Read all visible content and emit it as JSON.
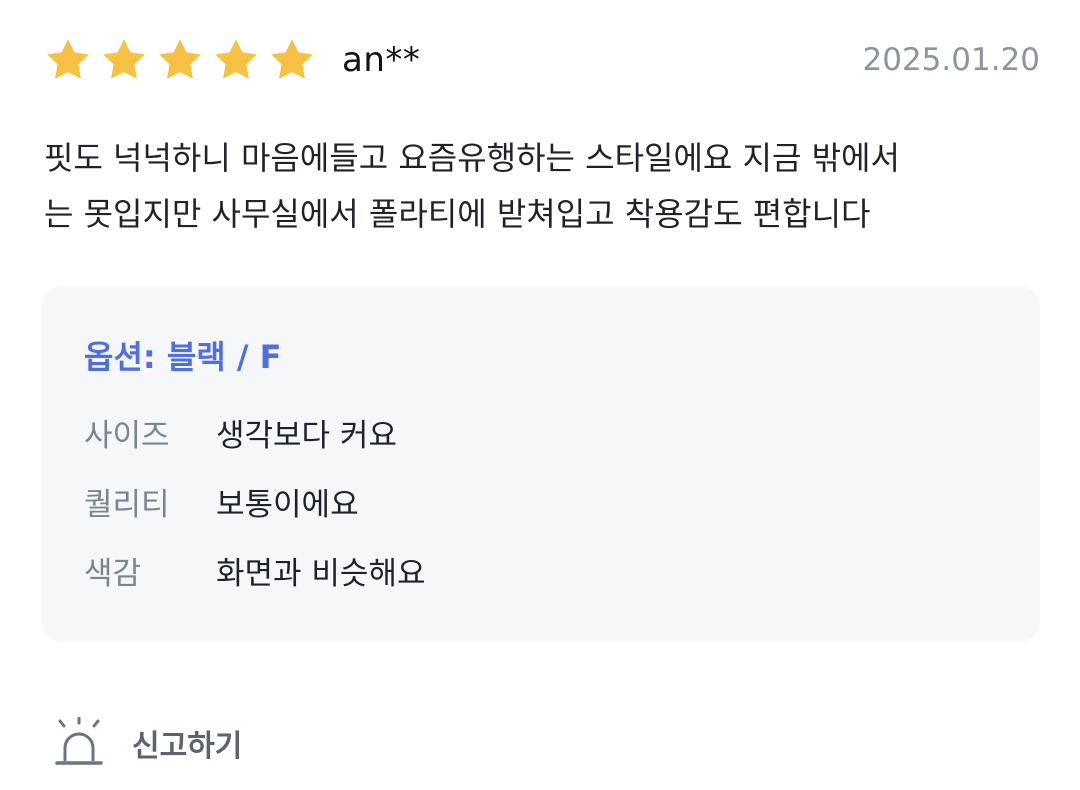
{
  "review": {
    "rating": 5,
    "rating_max": 5,
    "reviewer": "an**",
    "date": "2025.01.20",
    "text_lines": [
      "핏도 넉넉하니 마음에들고 요즘유행하는 스타일에요 지금 밖에서",
      "는 못입지만 사무실에서 폴라티에 받쳐입고 착용감도 편합니다"
    ]
  },
  "options": {
    "title": "옵션: 블랙 / F",
    "attributes": [
      {
        "label": "사이즈",
        "value": "생각보다 커요"
      },
      {
        "label": "퀄리티",
        "value": "보통이에요"
      },
      {
        "label": "색감",
        "value": "화면과 비슷해요"
      }
    ]
  },
  "report": {
    "label": "신고하기",
    "icon": "siren-icon"
  },
  "colors": {
    "star": "#f7c144",
    "accent": "#4f6ee1",
    "muted": "#8b95a1",
    "panel": "#f6f7f9"
  }
}
